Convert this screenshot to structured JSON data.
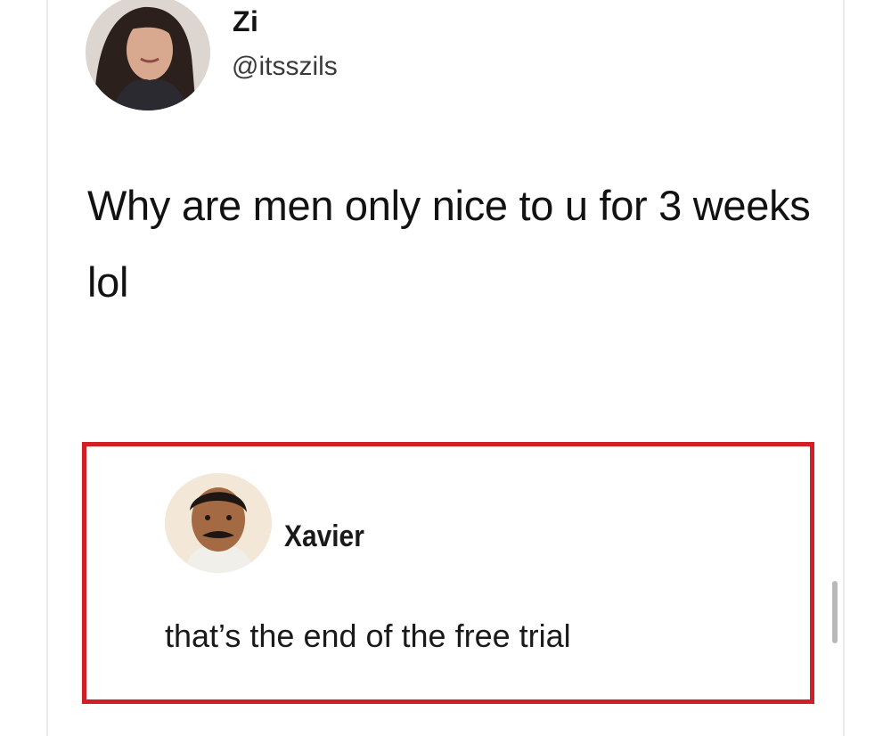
{
  "tweet": {
    "author": {
      "display_name": "Zi",
      "handle": "@itsszils"
    },
    "text": "Why are men only nice to u for 3 weeks lol"
  },
  "reply": {
    "author": {
      "display_name": "Xavier"
    },
    "text": "that’s the end of the free trial"
  },
  "colors": {
    "highlight_border": "#d21f25",
    "text": "#141414",
    "handle": "#3a3a3a"
  },
  "icons": {
    "scroll": "scrollbar-thumb"
  }
}
